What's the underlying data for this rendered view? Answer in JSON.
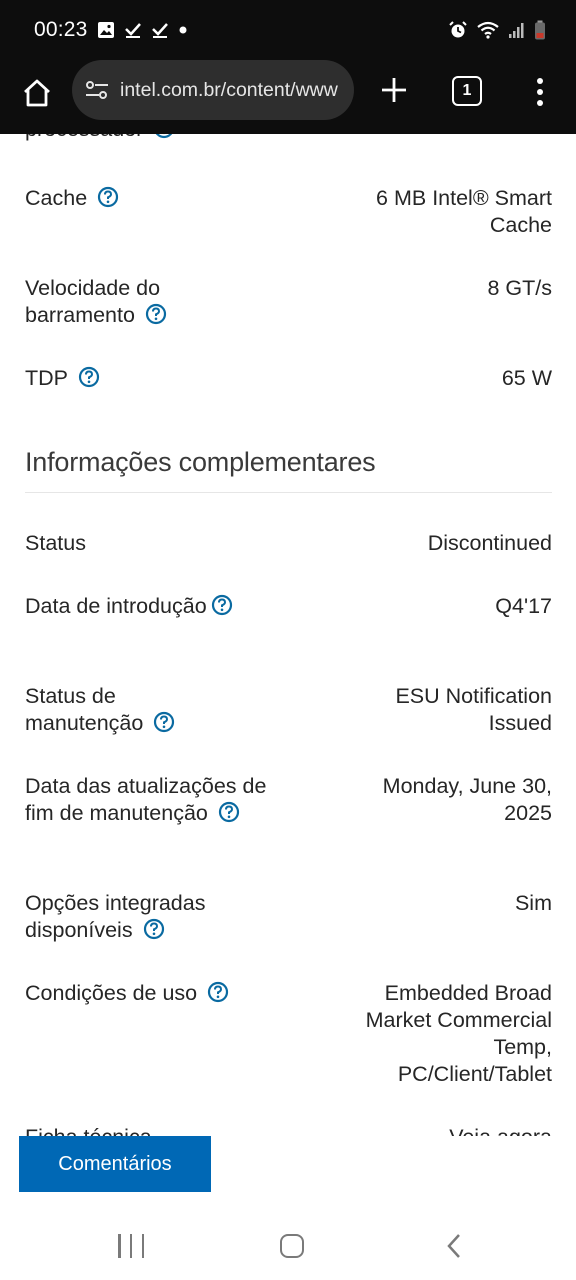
{
  "status_bar": {
    "time": "00:23",
    "left_icons": [
      "gallery-icon",
      "check-icon",
      "check-icon",
      "dot-icon"
    ],
    "right_icons": [
      "alarm-icon",
      "wifi-icon",
      "signal-icon",
      "battery-icon"
    ]
  },
  "toolbar": {
    "url": "intel.com.br/content/www",
    "tab_count": "1"
  },
  "content": {
    "cut_label": "processador",
    "rows_top": [
      {
        "label": "Cache",
        "value": "6 MB Intel® Smart Cache",
        "help": true
      },
      {
        "label": "Velocidade do barramento",
        "value": "8 GT/s",
        "help": true
      },
      {
        "label": "TDP",
        "value": "65 W",
        "help": true
      }
    ],
    "section_title": "Informações complementares",
    "rows_section": [
      {
        "label": "Status",
        "value": "Discontinued",
        "help": false
      },
      {
        "label": "Data de introdução",
        "value": "Q4'17",
        "help": true
      },
      {
        "label": "Status de manutenção",
        "value": "ESU Notification Issued",
        "help": true
      },
      {
        "label": "Data das atualizações de fim de manutenção",
        "value": "Monday, June 30, 2025",
        "help": true
      },
      {
        "label": "Opções integradas disponíveis",
        "value": "Sim",
        "help": true
      },
      {
        "label": "Condições de uso",
        "value": "Embedded Broad Market Commercial Temp, PC/Client/Tablet",
        "help": true
      }
    ],
    "datasheet": {
      "label": "Ficha técnica",
      "link": "Veja agora"
    }
  },
  "feedback_button": "Comentários",
  "colors": {
    "accent": "#0068b5",
    "help_icon": "#0a6aa1",
    "bar_bg": "#0d0d0d"
  }
}
